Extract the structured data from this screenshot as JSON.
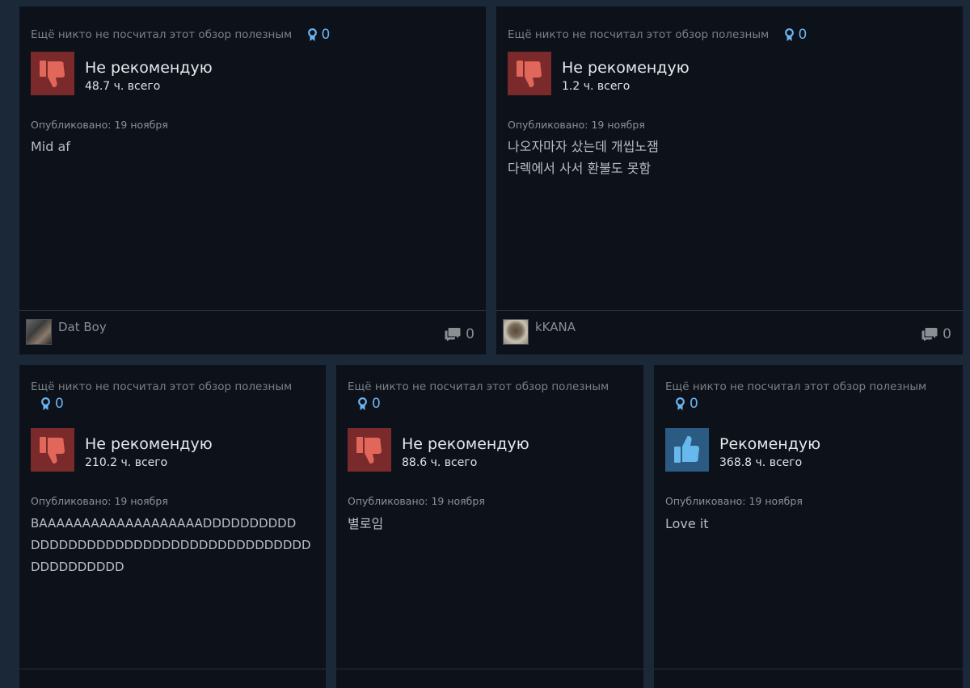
{
  "reviews": [
    {
      "helpful_text": "Ещё никто не посчитал этот обзор полезным",
      "award_count": "0",
      "verdict": "Не рекомендую",
      "verdict_icon": "thumbs-down-icon",
      "hours": "48.7 ч. всего",
      "posted": "Опубликовано: 19 ноября",
      "lines": [
        "Mid af"
      ],
      "author": "Dat Boy",
      "comment_count": "0"
    },
    {
      "helpful_text": "Ещё никто не посчитал этот обзор полезным",
      "award_count": "0",
      "verdict": "Не рекомендую",
      "verdict_icon": "thumbs-down-icon",
      "hours": "1.2 ч. всего",
      "posted": "Опубликовано: 19 ноября",
      "lines": [
        "나오자마자 샀는데 개씹노잼",
        "다렉에서 사서 환불도 못함"
      ],
      "author": "kKANA",
      "comment_count": "0"
    },
    {
      "helpful_text": "Ещё никто не посчитал этот обзор полезным",
      "award_count": "0",
      "verdict": "Не рекомендую",
      "verdict_icon": "thumbs-down-icon",
      "hours": "210.2 ч. всего",
      "posted": "Опубликовано: 19 ноября",
      "lines": [
        "BAAAAAAAAAAAAAAAAAAADDDDDDDDDD",
        "DDDDDDDDDDDDDDDDDDDDDDDDDDDDDD",
        "DDDDDDDDDD"
      ]
    },
    {
      "helpful_text": "Ещё никто не посчитал этот обзор полезным",
      "award_count": "0",
      "verdict": "Не рекомендую",
      "verdict_icon": "thumbs-down-icon",
      "hours": "88.6 ч. всего",
      "posted": "Опубликовано: 19 ноября",
      "lines": [
        "별로임"
      ]
    },
    {
      "helpful_text": "Ещё никто не посчитал этот обзор полезным",
      "award_count": "0",
      "verdict": "Рекомендую",
      "verdict_icon": "thumbs-up-icon",
      "hours": "368.8 ч. всего",
      "posted": "Опубликовано: 19 ноября",
      "lines": [
        "Love it"
      ]
    }
  ],
  "colors": {
    "page_bg": "#1b2838",
    "card_bg": "#0c111a",
    "negative": "#7a2a2a",
    "positive": "#2b5b83",
    "award": "#6cb4f0"
  }
}
